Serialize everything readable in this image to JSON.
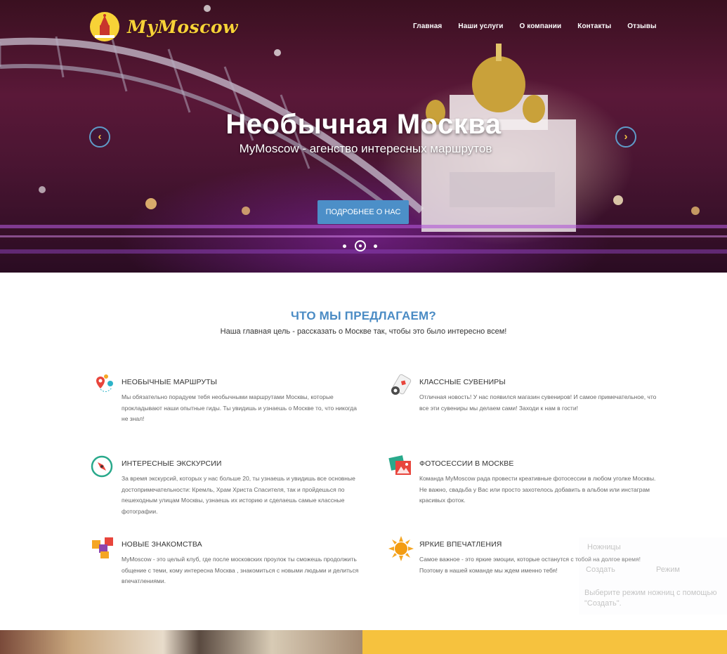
{
  "site": {
    "logo_text": "MyMoscow"
  },
  "nav": {
    "items": [
      "Главная",
      "Наши услуги",
      "О компании",
      "Контакты",
      "Отзывы"
    ]
  },
  "hero": {
    "title": "Необычная Москва",
    "subtitle": "MyMoscow - агенство интересных маршрутов",
    "cta_label": "ПОДРОБНЕЕ О НАС",
    "prev_symbol": "‹",
    "next_symbol": "›",
    "slides_count": 3,
    "active_slide": 2
  },
  "services_section": {
    "title": "ЧТО МЫ ПРЕДЛАГАЕМ?",
    "subtitle": "Наша главная цель - рассказать о Москве так, чтобы это было интересно всем!",
    "items": [
      {
        "icon": "route-pin-icon",
        "title": "НЕОБЫЧНЫЕ МАРШРУТЫ",
        "text": "Мы обязательно порадуем тебя необычными маршрутами Москвы, которые прокладывают наши опытные гиды. Ты увидишь и узнаешь о Москве то, что никогда не знал!"
      },
      {
        "icon": "souvenir-card-icon",
        "title": "КЛАССНЫЕ СУВЕНИРЫ",
        "text": "Отличная новость! У нас появился магазин сувениров! И самое примечательное, что все эти сувениры мы делаем сами! Заходи к нам в гости!"
      },
      {
        "icon": "compass-icon",
        "title": "ИНТЕРЕСНЫЕ ЭКСКУРСИИ",
        "text": "За время экскурсий, которых у нас больше 20, ты узнаешь и увидишь все основные достопримечательности: Кремль, Храм Христа Спасителя, так и пройдешься по пешеходным улицам Москвы, узнаешь их историю и сделаешь самые классные фотографии."
      },
      {
        "icon": "photo-stack-icon",
        "title": "ФОТОСЕССИИ В МОСКВЕ",
        "text": "Команда MyMoscow рада провести креативные фотосессии в любом уголке Москвы. Не важно, свадьба у Вас или просто захотелось добавить в альбом или инстаграм красивых фоток."
      },
      {
        "icon": "puzzle-icon",
        "title": "НОВЫЕ ЗНАКОМСТВА",
        "text": "MyMoscow - это целый клуб, где после московских проулок ты сможешь продолжить общение с теми, кому интересна Москва , знакомиться с новыми людьми и делиться впечатлениями."
      },
      {
        "icon": "sun-icon",
        "title": "ЯРКИЕ ВПЕЧАТЛЕНИЯ",
        "text": "Самое важное - это яркие эмоции, которые останутся с тобой на долгое время! Поэтому в нашей команде мы ждем именно тебя!"
      }
    ]
  },
  "snipping_tool": {
    "title": "Ножницы",
    "create_label": "Создать",
    "mode_label": "Режим",
    "hint": "Выберите режим ножниц с помощью \"Создать\"."
  },
  "colors": {
    "accent_blue": "#4a8bc4",
    "logo_yellow": "#f7d237",
    "cta_blue": "#4c8fc8",
    "bottom_yellow": "#f6c23e"
  }
}
